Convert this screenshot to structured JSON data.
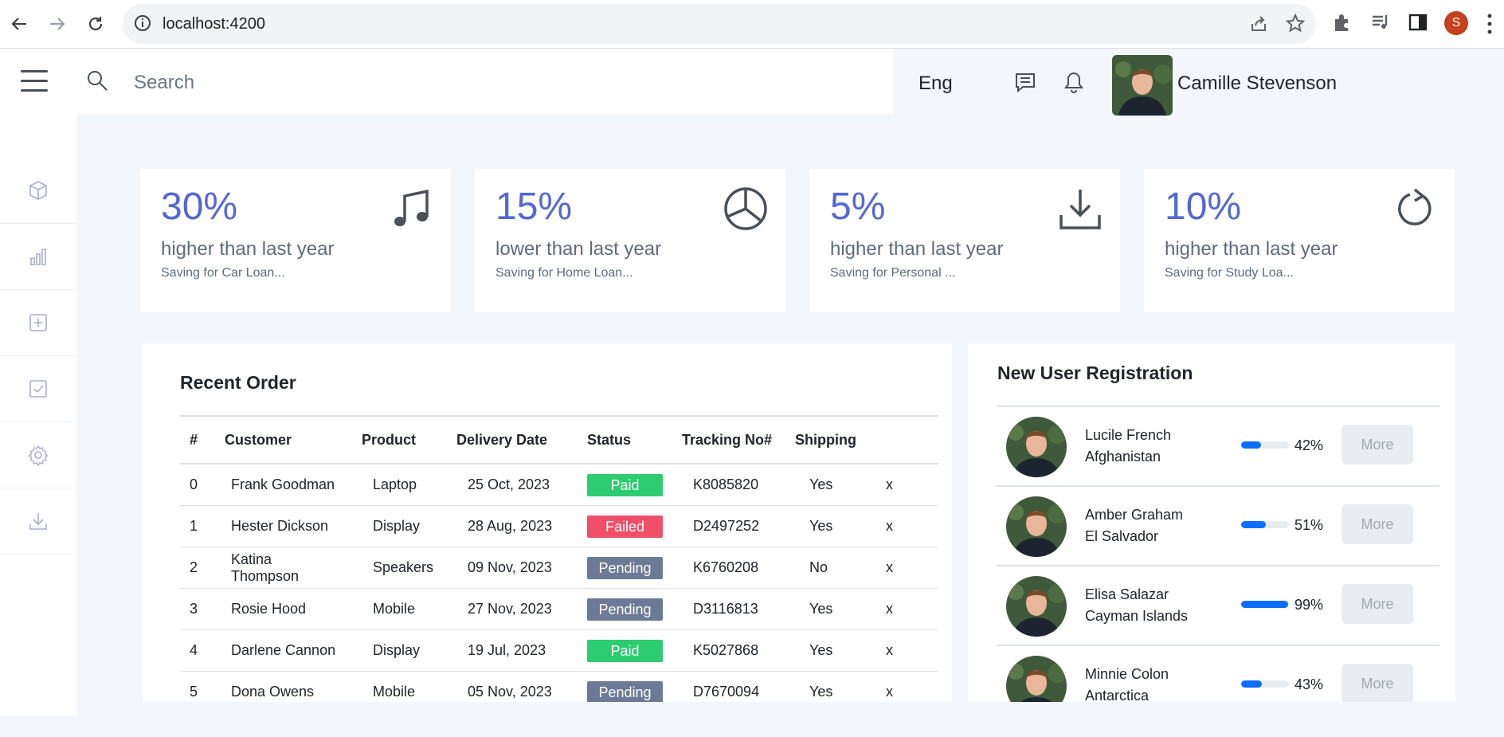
{
  "browser": {
    "url": "localhost:4200",
    "profile_initial": "S"
  },
  "topbar": {
    "search_placeholder": "Search",
    "language": "Eng",
    "user_name": "Camille Stevenson"
  },
  "sidebar": {
    "items": [
      {
        "icon": "cube-icon"
      },
      {
        "icon": "bar-chart-icon"
      },
      {
        "icon": "plus-square-icon"
      },
      {
        "icon": "check-square-icon"
      },
      {
        "icon": "gear-icon"
      },
      {
        "icon": "download-icon"
      }
    ]
  },
  "stats": [
    {
      "percent": "30%",
      "desc": "higher than last year",
      "sub": "Saving for Car Loan...",
      "icon": "music-note-icon"
    },
    {
      "percent": "15%",
      "desc": "lower than last year",
      "sub": "Saving for Home Loan...",
      "icon": "pie-chart-icon"
    },
    {
      "percent": "5%",
      "desc": "higher than last year",
      "sub": "Saving for Personal ...",
      "icon": "download-icon"
    },
    {
      "percent": "10%",
      "desc": "higher than last year",
      "sub": "Saving for Study Loa...",
      "icon": "refresh-icon"
    }
  ],
  "orders": {
    "title": "Recent Order",
    "columns": [
      "#",
      "Customer",
      "Product",
      "Delivery Date",
      "Status",
      "Tracking No#",
      "Shipping",
      ""
    ],
    "rows": [
      {
        "n": "0",
        "customer": "Frank Goodman",
        "product": "Laptop",
        "date": "25 Oct, 2023",
        "status": "Paid",
        "tracking": "K8085820",
        "shipping": "Yes",
        "x": "x"
      },
      {
        "n": "1",
        "customer": "Hester Dickson",
        "product": "Display",
        "date": "28 Aug, 2023",
        "status": "Failed",
        "tracking": "D2497252",
        "shipping": "Yes",
        "x": "x"
      },
      {
        "n": "2",
        "customer": "Katina Thompson",
        "product": "Speakers",
        "date": "09 Nov, 2023",
        "status": "Pending",
        "tracking": "K6760208",
        "shipping": "No",
        "x": "x"
      },
      {
        "n": "3",
        "customer": "Rosie Hood",
        "product": "Mobile",
        "date": "27 Nov, 2023",
        "status": "Pending",
        "tracking": "D3116813",
        "shipping": "Yes",
        "x": "x"
      },
      {
        "n": "4",
        "customer": "Darlene Cannon",
        "product": "Display",
        "date": "19 Jul, 2023",
        "status": "Paid",
        "tracking": "K5027868",
        "shipping": "Yes",
        "x": "x"
      },
      {
        "n": "5",
        "customer": "Dona Owens",
        "product": "Mobile",
        "date": "05 Nov, 2023",
        "status": "Pending",
        "tracking": "D7670094",
        "shipping": "Yes",
        "x": "x"
      }
    ],
    "status_colors": {
      "Paid": "#2ecc71",
      "Failed": "#ef5068",
      "Pending": "#6c7a96"
    }
  },
  "registrations": {
    "title": "New User Registration",
    "more_label": "More",
    "users": [
      {
        "name": "Lucile French",
        "country": "Afghanistan",
        "progress": 0.42,
        "label": "42%"
      },
      {
        "name": "Amber Graham",
        "country": "El Salvador",
        "progress": 0.51,
        "label": "51%"
      },
      {
        "name": "Elisa Salazar",
        "country": "Cayman Islands",
        "progress": 0.99,
        "label": "99%"
      },
      {
        "name": "Minnie Colon",
        "country": "Antarctica",
        "progress": 0.43,
        "label": "43%"
      }
    ]
  },
  "colors": {
    "accent": "#5468d4",
    "background": "#f3f6fb",
    "progress": "#0d6efd"
  }
}
